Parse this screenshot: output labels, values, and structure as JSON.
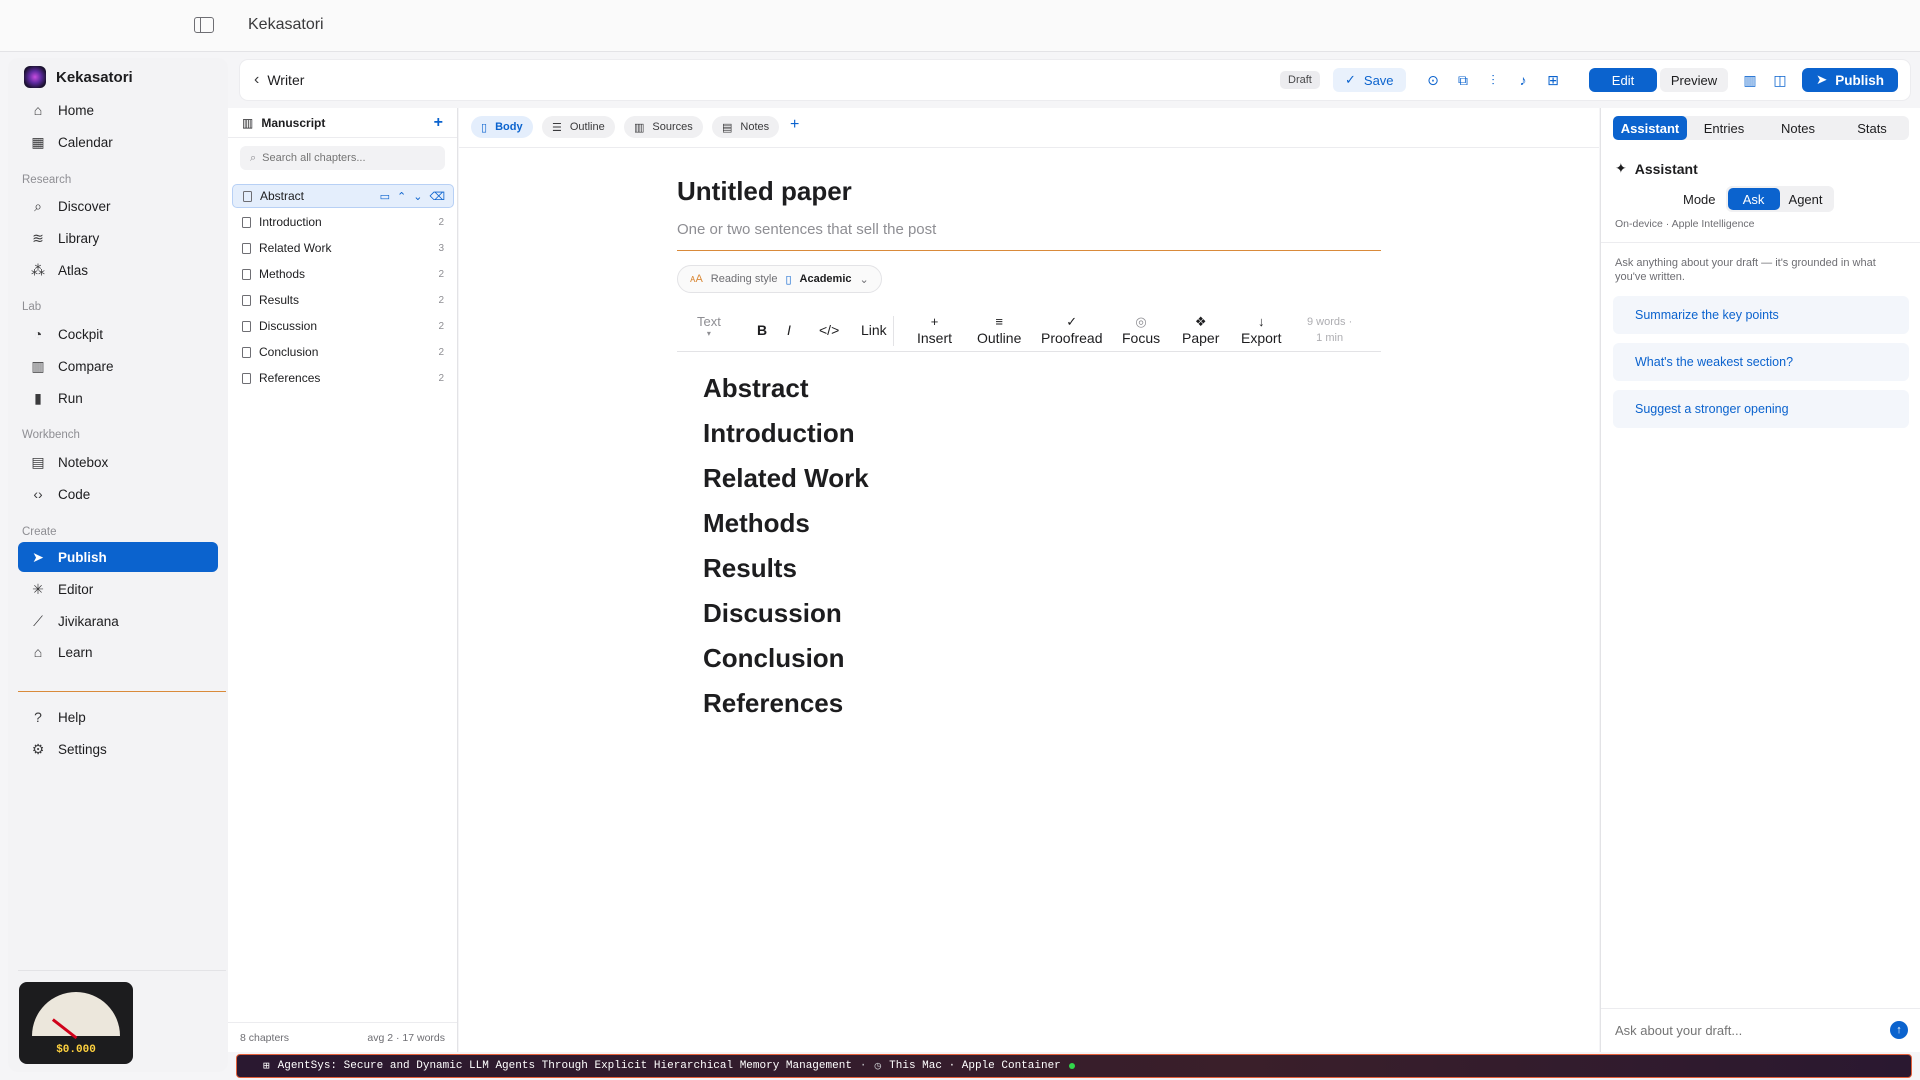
{
  "app": {
    "title": "Kekasatori"
  },
  "sidebar": {
    "brand": "Kekasatori",
    "top_items": [
      {
        "label": "Home",
        "icon": "home-icon"
      },
      {
        "label": "Calendar",
        "icon": "calendar-icon"
      }
    ],
    "sections": [
      {
        "title": "Research",
        "items": [
          {
            "label": "Discover",
            "icon": "search-icon"
          },
          {
            "label": "Library",
            "icon": "stack-icon"
          },
          {
            "label": "Atlas",
            "icon": "graph-icon"
          }
        ]
      },
      {
        "title": "Lab",
        "items": [
          {
            "label": "Cockpit",
            "icon": "gauge-icon"
          },
          {
            "label": "Compare",
            "icon": "columns-icon"
          },
          {
            "label": "Run",
            "icon": "bar-chart-icon"
          }
        ]
      },
      {
        "title": "Workbench",
        "items": [
          {
            "label": "Notebox",
            "icon": "notebook-icon"
          },
          {
            "label": "Code",
            "icon": "code-icon"
          }
        ]
      },
      {
        "title": "Create",
        "items": [
          {
            "label": "Publish",
            "icon": "send-icon",
            "active": true
          },
          {
            "label": "Editor",
            "icon": "sparkle-icon"
          },
          {
            "label": "Jivikarana",
            "icon": "wand-icon"
          },
          {
            "label": "Learn",
            "icon": "graduation-cap-icon"
          }
        ]
      }
    ],
    "bottom_items": [
      {
        "label": "Help",
        "icon": "help-icon"
      },
      {
        "label": "Settings",
        "icon": "gear-icon"
      }
    ],
    "cost": "$0.000"
  },
  "header": {
    "back_label": "Writer",
    "status": "Draft",
    "save_label": "Save",
    "edit_label": "Edit",
    "preview_label": "Preview",
    "publish_label": "Publish"
  },
  "manuscript": {
    "title": "Manuscript",
    "search_placeholder": "Search all chapters...",
    "chapters": [
      {
        "label": "Abstract",
        "count": ""
      },
      {
        "label": "Introduction",
        "count": "2"
      },
      {
        "label": "Related Work",
        "count": "3"
      },
      {
        "label": "Methods",
        "count": "2"
      },
      {
        "label": "Results",
        "count": "2"
      },
      {
        "label": "Discussion",
        "count": "2"
      },
      {
        "label": "Conclusion",
        "count": "2"
      },
      {
        "label": "References",
        "count": "2"
      }
    ],
    "footer_left": "8 chapters",
    "footer_right": "avg 2 · 17 words"
  },
  "editor": {
    "tabs": [
      "Body",
      "Outline",
      "Sources",
      "Notes"
    ],
    "title": "Untitled paper",
    "subtitle_placeholder": "One or two sentences that sell the post",
    "reading_style_label": "Reading style",
    "reading_style_value": "Academic",
    "toolbar": {
      "text": "Text",
      "bold": "B",
      "italic": "I",
      "code": "</>",
      "link": "Link",
      "insert": "Insert",
      "outline": "Outline",
      "proofread": "Proofread",
      "focus": "Focus",
      "paper": "Paper",
      "export": "Export",
      "words": "9 words ·",
      "read_time": "1 min"
    },
    "headings": [
      "Abstract",
      "Introduction",
      "Related Work",
      "Methods",
      "Results",
      "Discussion",
      "Conclusion",
      "References"
    ]
  },
  "assistant": {
    "tabs": [
      "Assistant",
      "Entries",
      "Notes",
      "Stats"
    ],
    "title": "Assistant",
    "mode_label": "Mode",
    "modes": [
      "Ask",
      "Agent"
    ],
    "device": "On-device · Apple Intelligence",
    "intro": "Ask anything about your draft — it's grounded in what you've written.",
    "suggestions": [
      "Summarize the key points",
      "What's the weakest section?",
      "Suggest a stronger opening"
    ],
    "input_placeholder": "Ask about your draft..."
  },
  "statusbar": {
    "paper": "AgentSys: Secure and Dynamic LLM Agents Through Explicit Hierarchical Memory Management",
    "separator": "·",
    "host": "This Mac · Apple Container"
  }
}
